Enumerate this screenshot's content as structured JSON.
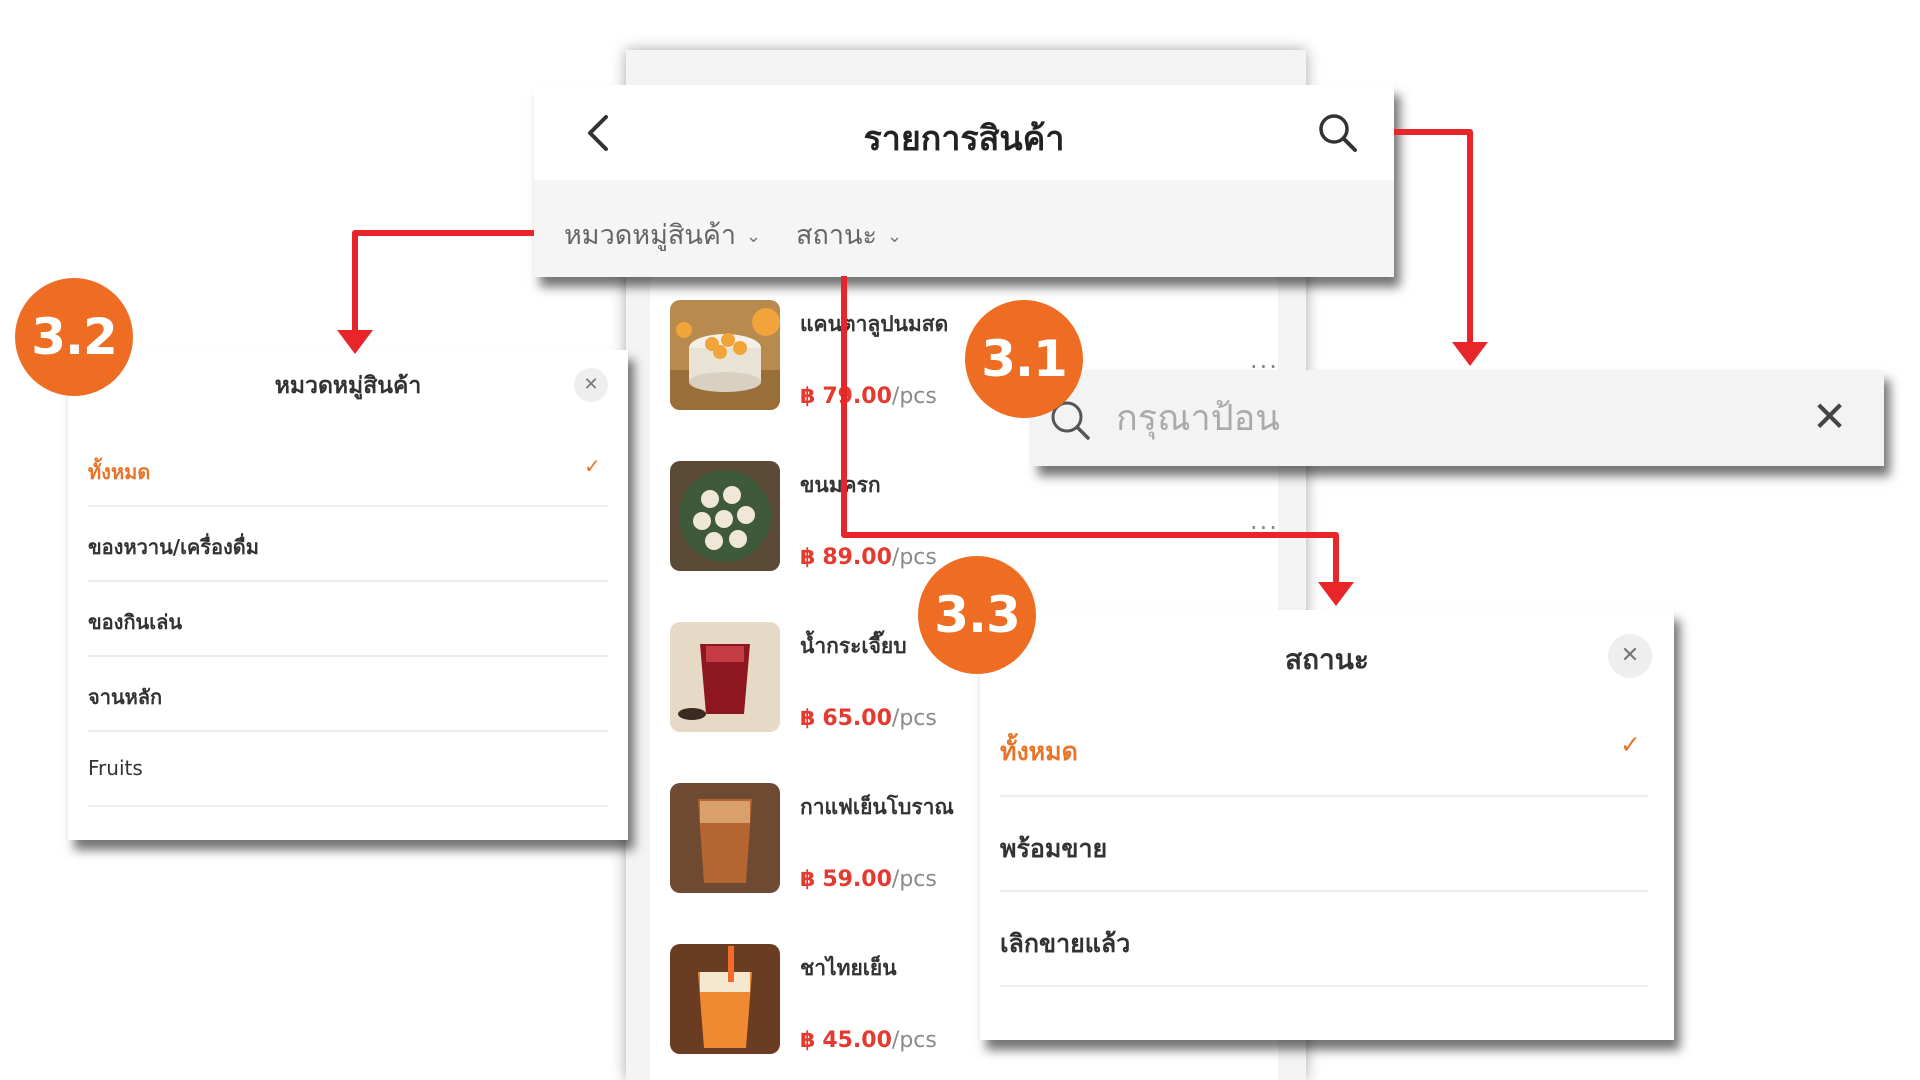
{
  "header": {
    "title": "รายการสินค้า"
  },
  "filters": [
    {
      "label": "หมวดหมู่สินค้า"
    },
    {
      "label": "สถานะ"
    }
  ],
  "products": [
    {
      "name": "แคนตาลูปนมสด",
      "currency": "฿",
      "price": "79.00",
      "unit": "/pcs"
    },
    {
      "name": "ขนมครก",
      "currency": "฿",
      "price": "89.00",
      "unit": "/pcs"
    },
    {
      "name": "น้ำกระเจี๊ยบ",
      "currency": "฿",
      "price": "65.00",
      "unit": "/pcs"
    },
    {
      "name": "กาแฟเย็นโบราณ",
      "currency": "฿",
      "price": "59.00",
      "unit": "/pcs"
    },
    {
      "name": "ชาไทยเย็น",
      "currency": "฿",
      "price": "45.00",
      "unit": "/pcs"
    }
  ],
  "more_label": "...",
  "search": {
    "placeholder": "กรุณาป้อน",
    "value": ""
  },
  "category_sheet": {
    "title": "หมวดหมู่สินค้า",
    "options": [
      {
        "label": "ทั้งหมด",
        "selected": true
      },
      {
        "label": "ของหวาน/เครื่องดื่ม",
        "selected": false
      },
      {
        "label": "ของกินเล่น",
        "selected": false
      },
      {
        "label": "จานหลัก",
        "selected": false
      },
      {
        "label": "Fruits",
        "selected": false
      }
    ]
  },
  "status_sheet": {
    "title": "สถานะ",
    "options": [
      {
        "label": "ทั้งหมด",
        "selected": true
      },
      {
        "label": "พร้อมขาย",
        "selected": false
      },
      {
        "label": "เลิกขายแล้ว",
        "selected": false
      }
    ]
  },
  "badges": {
    "search": "3.1",
    "category": "3.2",
    "status": "3.3"
  },
  "colors": {
    "accent": "#ee6d22",
    "price": "#e53a2f",
    "arrow": "#e8262a",
    "selected": "#e8742a"
  }
}
